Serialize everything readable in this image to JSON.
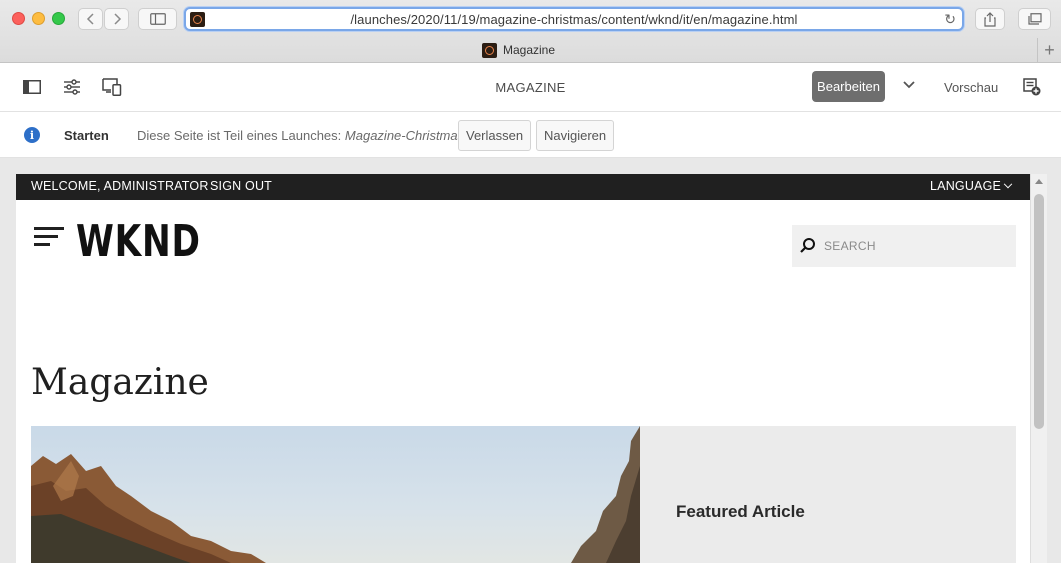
{
  "browser": {
    "url": "/launches/2020/11/19/magazine-christmas/content/wknd/it/en/magazine.html",
    "tab_title": "Magazine"
  },
  "editor": {
    "page_title": "MAGAZINE",
    "edit_label": "Bearbeiten",
    "preview_label": "Vorschau",
    "edit_button_color": "#6e6e6e"
  },
  "launch": {
    "start_label": "Starten",
    "message": "Diese Seite ist Teil eines Launches:",
    "launch_name": "Magazine-Christmas",
    "leave_label": "Verlassen",
    "navigate_label": "Navigieren"
  },
  "site": {
    "welcome": "WELCOME, ADMINISTRATOR",
    "sign_out": "SIGN OUT",
    "language": "LANGUAGE",
    "logo": "WKND",
    "search_placeholder": "SEARCH",
    "heading": "Magazine",
    "featured_label": "Featured Article"
  }
}
